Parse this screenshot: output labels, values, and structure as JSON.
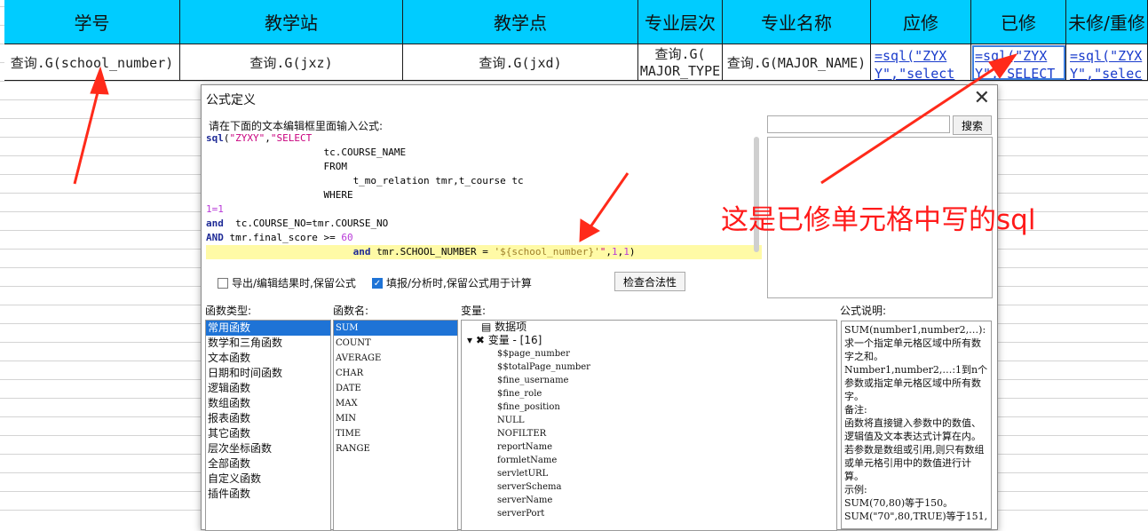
{
  "sheet": {
    "headers": [
      "学号",
      "教学站",
      "教学点",
      "专业层次",
      "专业名称",
      "应修",
      "已修",
      "未修/重修"
    ],
    "cells": [
      "查询.G(school_number)",
      "查询.G(jxz)",
      "查询.G(jxd)",
      "查询.G(\nMAJOR_TYPE",
      "查询.G(MAJOR_NAME)",
      "=sql(\"ZYXY\",\"select",
      "=sql(\"ZYXY\",\"SELECT",
      "=sql(\"ZYXY\",\"select"
    ],
    "colors": {
      "header_bg": "#00ccff",
      "formula": "#1a3ccc",
      "selection": "#3d7fe0"
    }
  },
  "dialog": {
    "title": "公式定义",
    "close_icon": "close-icon",
    "prompt": "请在下面的文本编辑框里面输入公式:",
    "formula_lines": [
      "sql(\"ZYXY\",\"SELECT",
      "                    tc.COURSE_NAME",
      "                    FROM",
      "                         t_mo_relation tmr,t_course tc",
      "                    WHERE",
      "1=1",
      "and  tc.COURSE_NO=tmr.COURSE_NO",
      "AND tmr.final_score >= 60",
      "                         and tmr.SCHOOL_NUMBER = '${school_number}'\",1,1)"
    ],
    "search_button": "搜索",
    "search_placeholder": "",
    "check_keep_export": "导出/编辑结果时,保留公式",
    "check_keep_fill": "填报/分析时,保留公式用于计算",
    "validate_button": "检查合法性",
    "func_type_label": "函数类型:",
    "func_name_label": "函数名:",
    "vars_label": "变量:",
    "desc_label": "公式说明:",
    "func_types": [
      "常用函数",
      "数学和三角函数",
      "文本函数",
      "日期和时间函数",
      "逻辑函数",
      "数组函数",
      "报表函数",
      "其它函数",
      "层次坐标函数",
      "全部函数",
      "自定义函数",
      "插件函数"
    ],
    "func_names": [
      "SUM",
      "COUNT",
      "AVERAGE",
      "CHAR",
      "DATE",
      "MAX",
      "MIN",
      "TIME",
      "RANGE"
    ],
    "var_tree": {
      "data_item": "数据项",
      "vars_group": "变量 - [16]",
      "vars": [
        "$$page_number",
        "$$totalPage_number",
        "$fine_username",
        "$fine_role",
        "$fine_position",
        "NULL",
        "NOFILTER",
        "reportName",
        "formletName",
        "servletURL",
        "serverSchema",
        "serverName",
        "serverPort"
      ]
    },
    "description": "SUM(number1,number2,…):求一个指定单元格区域中所有数字之和。\nNumber1,number2,…:1到n个参数或指定单元格区域中所有数字。\n备注:\n函数将直接键入参数中的数值、逻辑值及文本表达式计算在内。若参数是数组或引用,则只有数组或单元格引用中的数值进行计算。\n示例:\nSUM(70,80)等于150。\nSUM(\"70\",80,TRUE)等于151,"
  },
  "annotation": {
    "text": "这是已修单元格中写的sql",
    "color": "#ff1a1a"
  }
}
